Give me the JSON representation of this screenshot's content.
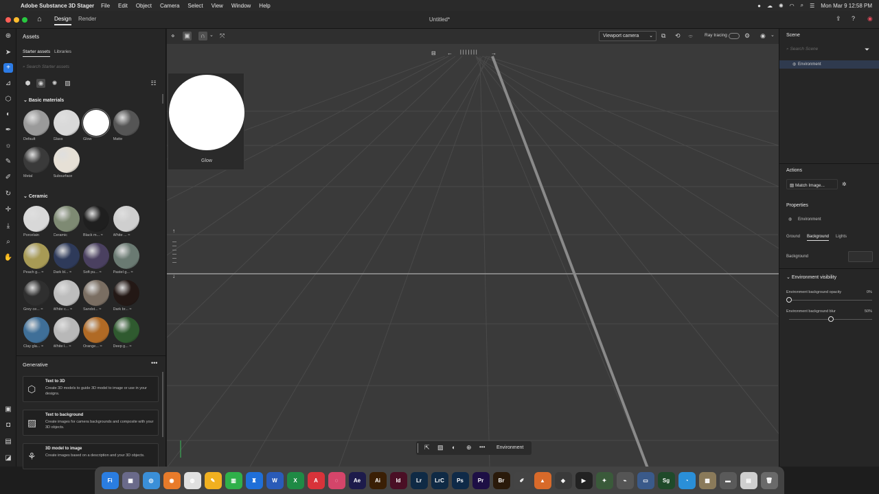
{
  "menubar": {
    "app_name": "Adobe Substance 3D Stager",
    "items": [
      "File",
      "Edit",
      "Object",
      "Camera",
      "Select",
      "View",
      "Window",
      "Help"
    ],
    "clock": "Mon Mar 9  12:58 PM"
  },
  "titlebar": {
    "tabs": [
      "Design",
      "Render"
    ],
    "active_tab": "Design",
    "document_title": "Untitled*"
  },
  "assets": {
    "title": "Assets",
    "subtabs": [
      "Starter assets",
      "Libraries"
    ],
    "search_placeholder": "Search Starter assets",
    "sections": {
      "basic": {
        "title": "Basic materials",
        "items": [
          {
            "label": "Default",
            "color": "#9a9a9a"
          },
          {
            "label": "Glass",
            "color": "#d9d9d9"
          },
          {
            "label": "Glow",
            "color": "#ffffff"
          },
          {
            "label": "Matte",
            "color": "#555555"
          },
          {
            "label": "Metal",
            "color": "#3a3a3a"
          },
          {
            "label": "Subsurface",
            "color": "#e6e0d6"
          }
        ]
      },
      "ceramic": {
        "title": "Ceramic",
        "items": [
          {
            "label": "Porcelain",
            "color": "#d8d8d8"
          },
          {
            "label": "Ceramic",
            "color": "#7e8a73"
          },
          {
            "label": "Black m... ≈",
            "color": "#1f1f1f"
          },
          {
            "label": "White ... ≈",
            "color": "#cfcfcf"
          },
          {
            "label": "Peach g... ≈",
            "color": "#a79a55"
          },
          {
            "label": "Dark bl... ≈",
            "color": "#2e3a5a"
          },
          {
            "label": "Soft pu... ≈",
            "color": "#4a4060"
          },
          {
            "label": "Pastel g... ≈",
            "color": "#6a7a72"
          },
          {
            "label": "Grey ce... ≈",
            "color": "#2f2f2f"
          },
          {
            "label": "White c... ≈",
            "color": "#bdbdbd"
          },
          {
            "label": "Sandst... ≈",
            "color": "#7a6e62"
          },
          {
            "label": "Dark br... ≈",
            "color": "#231815"
          },
          {
            "label": "Clay gla... ≈",
            "color": "#3f6f98"
          },
          {
            "label": "White l... ≈",
            "color": "#b8b8b8"
          },
          {
            "label": "Orange... ≈",
            "color": "#b06a25"
          },
          {
            "label": "Deep g... ≈",
            "color": "#2f5a2f"
          }
        ]
      }
    }
  },
  "generative": {
    "title": "Generative",
    "cards": [
      {
        "title": "Text to 3D",
        "desc": "Create 3D models to guide 3D model to image or use in your designs."
      },
      {
        "title": "Text to background",
        "desc": "Create images for camera backgrounds and composite with your 3D objects."
      },
      {
        "title": "3D model to image",
        "desc": "Create images based on a description and your 3D objects."
      }
    ]
  },
  "viewport": {
    "camera": "Viewport camera",
    "ray_tracing": "Ray tracing",
    "preview_label": "Glow",
    "bottom_label": "Environment"
  },
  "scene": {
    "title": "Scene",
    "search_placeholder": "Search Scene",
    "items": [
      "Environment"
    ],
    "actions_title": "Actions",
    "match_image": "Match Image...",
    "properties_title": "Properties",
    "properties_item": "Environment",
    "tabs": [
      "Ground",
      "Background",
      "Lights"
    ],
    "active_tab": "Background",
    "background_label": "Background",
    "visibility_title": "Environment visibility",
    "opacity_label": "Environment background opacity",
    "opacity_value": "0%",
    "opacity_fraction": 0.0,
    "blur_label": "Environment background blur",
    "blur_value": "50%",
    "blur_fraction": 0.5
  },
  "dock": {
    "apps": [
      {
        "label": "Fi",
        "color": "#2a7de1"
      },
      {
        "label": "▦",
        "color": "#6a6a8a"
      },
      {
        "label": "◎",
        "color": "#3a8fd8"
      },
      {
        "label": "◉",
        "color": "#e87b2a"
      },
      {
        "label": "◍",
        "color": "#e0e0e0"
      },
      {
        "label": "✎",
        "color": "#f0b020"
      },
      {
        "label": "▥",
        "color": "#2fb04a"
      },
      {
        "label": "♜",
        "color": "#1f6fd8"
      },
      {
        "label": "W",
        "color": "#2a5bb8"
      },
      {
        "label": "X",
        "color": "#1f8a45"
      },
      {
        "label": "A",
        "color": "#d8333a"
      },
      {
        "label": "◌",
        "color": "#d4456a"
      },
      {
        "label": "Ae",
        "color": "#1d1b4b"
      },
      {
        "label": "Ai",
        "color": "#3a1f05"
      },
      {
        "label": "Id",
        "color": "#4a0f25"
      },
      {
        "label": "Lr",
        "color": "#0f2a45"
      },
      {
        "label": "LrC",
        "color": "#0f2a45"
      },
      {
        "label": "Ps",
        "color": "#0f2a48"
      },
      {
        "label": "Pr",
        "color": "#1d0f45"
      },
      {
        "label": "Br",
        "color": "#2a1a0a"
      },
      {
        "label": "✐",
        "color": "#444444"
      },
      {
        "label": "▲",
        "color": "#d86a2a"
      },
      {
        "label": "◈",
        "color": "#3a3a3a"
      },
      {
        "label": "▶",
        "color": "#222222"
      },
      {
        "label": "✦",
        "color": "#3a5a3a"
      },
      {
        "label": "⌁",
        "color": "#555555"
      },
      {
        "label": "▭",
        "color": "#3a5a8a"
      },
      {
        "label": "Sg",
        "color": "#1f4a2a"
      },
      {
        "label": "◔",
        "color": "#2a8fd8"
      },
      {
        "label": "▩",
        "color": "#8a7a5a"
      },
      {
        "label": "▬",
        "color": "#5a5a5a"
      },
      {
        "label": "▤",
        "color": "#cfcfcf"
      },
      {
        "label": "🗑",
        "color": "#6a6a6a"
      }
    ]
  }
}
